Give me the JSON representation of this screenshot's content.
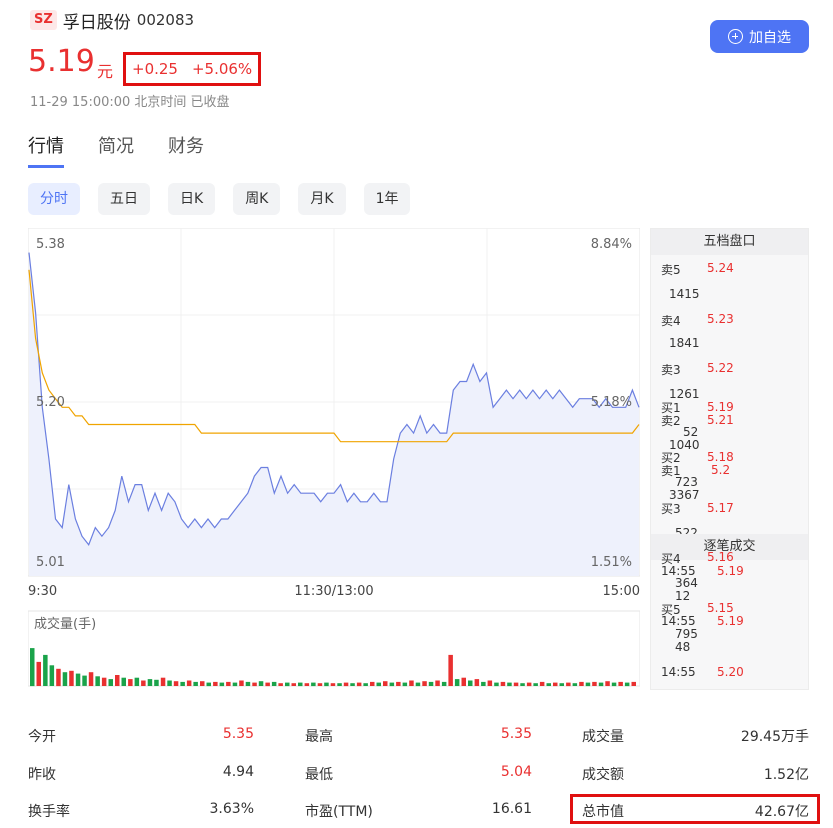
{
  "stock": {
    "market": "SZ",
    "name": "孚日股份",
    "code": "002083",
    "price": "5.19",
    "unit": "元",
    "change": "+0.25",
    "change_pct": "+5.06%",
    "timestamp": "11-29 15:00:00 北京时间 已收盘"
  },
  "add_button_label": "加自选",
  "tabs": [
    "行情",
    "简况",
    "财务"
  ],
  "period_tabs": [
    "分时",
    "五日",
    "日K",
    "周K",
    "月K",
    "1年"
  ],
  "chart_data": {
    "type": "line",
    "y_left_ticks": [
      "5.38",
      "5.20",
      "5.01"
    ],
    "y_right_ticks": [
      "8.84%",
      "5.18%",
      "1.51%"
    ],
    "x_ticks": [
      "9:30",
      "11:30/13:00",
      "15:00"
    ],
    "volume_label": "成交量(手)",
    "ylim": [
      5.01,
      5.38
    ],
    "prev_close": 4.94,
    "series": [
      {
        "color": "#6b7fe0",
        "values": [
          5.37,
          5.3,
          5.19,
          5.13,
          5.06,
          5.05,
          5.1,
          5.06,
          5.04,
          5.03,
          5.05,
          5.04,
          5.05,
          5.07,
          5.11,
          5.08,
          5.1,
          5.1,
          5.07,
          5.09,
          5.07,
          5.09,
          5.08,
          5.06,
          5.05,
          5.06,
          5.05,
          5.06,
          5.05,
          5.06,
          5.06,
          5.07,
          5.08,
          5.09,
          5.11,
          5.12,
          5.12,
          5.09,
          5.11,
          5.09,
          5.1,
          5.09,
          5.09,
          5.09,
          5.08,
          5.09,
          5.09,
          5.1,
          5.08,
          5.09,
          5.08,
          5.08,
          5.09,
          5.08,
          5.08,
          5.13,
          5.16,
          5.17,
          5.16,
          5.18,
          5.16,
          5.17,
          5.16,
          5.16,
          5.21,
          5.22,
          5.22,
          5.24,
          5.22,
          5.23,
          5.19,
          5.2,
          5.21,
          5.2,
          5.21,
          5.2,
          5.21,
          5.2,
          5.21,
          5.2,
          5.21,
          5.2,
          5.19,
          5.2,
          5.2,
          5.2,
          5.19,
          5.2,
          5.19,
          5.19,
          5.19,
          5.21,
          5.19
        ]
      },
      {
        "color": "#f0a400",
        "values": [
          5.35,
          5.27,
          5.23,
          5.21,
          5.2,
          5.19,
          5.19,
          5.18,
          5.18,
          5.17,
          5.17,
          5.17,
          5.17,
          5.17,
          5.17,
          5.17,
          5.17,
          5.17,
          5.17,
          5.17,
          5.17,
          5.17,
          5.17,
          5.17,
          5.17,
          5.17,
          5.16,
          5.16,
          5.16,
          5.16,
          5.16,
          5.16,
          5.16,
          5.16,
          5.16,
          5.16,
          5.16,
          5.16,
          5.16,
          5.16,
          5.16,
          5.16,
          5.16,
          5.16,
          5.16,
          5.16,
          5.16,
          5.15,
          5.15,
          5.15,
          5.15,
          5.15,
          5.15,
          5.15,
          5.15,
          5.15,
          5.15,
          5.15,
          5.15,
          5.15,
          5.15,
          5.15,
          5.15,
          5.15,
          5.16,
          5.16,
          5.16,
          5.16,
          5.16,
          5.16,
          5.16,
          5.16,
          5.16,
          5.16,
          5.16,
          5.16,
          5.16,
          5.16,
          5.16,
          5.16,
          5.16,
          5.16,
          5.16,
          5.16,
          5.16,
          5.16,
          5.16,
          5.16,
          5.16,
          5.16,
          5.16,
          5.16,
          5.17
        ]
      }
    ],
    "volume": [
      {
        "v": 0.55,
        "up": false
      },
      {
        "v": 0.35,
        "up": true
      },
      {
        "v": 0.45,
        "up": false
      },
      {
        "v": 0.3,
        "up": false
      },
      {
        "v": 0.25,
        "up": true
      },
      {
        "v": 0.2,
        "up": false
      },
      {
        "v": 0.22,
        "up": true
      },
      {
        "v": 0.18,
        "up": false
      },
      {
        "v": 0.15,
        "up": false
      },
      {
        "v": 0.2,
        "up": true
      },
      {
        "v": 0.14,
        "up": false
      },
      {
        "v": 0.12,
        "up": true
      },
      {
        "v": 0.1,
        "up": false
      },
      {
        "v": 0.16,
        "up": true
      },
      {
        "v": 0.12,
        "up": false
      },
      {
        "v": 0.1,
        "up": true
      },
      {
        "v": 0.12,
        "up": false
      },
      {
        "v": 0.08,
        "up": true
      },
      {
        "v": 0.1,
        "up": false
      },
      {
        "v": 0.09,
        "up": false
      },
      {
        "v": 0.12,
        "up": true
      },
      {
        "v": 0.08,
        "up": false
      },
      {
        "v": 0.07,
        "up": true
      },
      {
        "v": 0.06,
        "up": false
      },
      {
        "v": 0.08,
        "up": true
      },
      {
        "v": 0.06,
        "up": false
      },
      {
        "v": 0.07,
        "up": true
      },
      {
        "v": 0.05,
        "up": false
      },
      {
        "v": 0.06,
        "up": true
      },
      {
        "v": 0.05,
        "up": false
      },
      {
        "v": 0.06,
        "up": true
      },
      {
        "v": 0.05,
        "up": false
      },
      {
        "v": 0.08,
        "up": true
      },
      {
        "v": 0.06,
        "up": false
      },
      {
        "v": 0.05,
        "up": true
      },
      {
        "v": 0.07,
        "up": false
      },
      {
        "v": 0.05,
        "up": true
      },
      {
        "v": 0.06,
        "up": false
      },
      {
        "v": 0.04,
        "up": true
      },
      {
        "v": 0.05,
        "up": false
      },
      {
        "v": 0.04,
        "up": true
      },
      {
        "v": 0.05,
        "up": false
      },
      {
        "v": 0.04,
        "up": true
      },
      {
        "v": 0.05,
        "up": false
      },
      {
        "v": 0.04,
        "up": true
      },
      {
        "v": 0.05,
        "up": false
      },
      {
        "v": 0.04,
        "up": true
      },
      {
        "v": 0.04,
        "up": false
      },
      {
        "v": 0.05,
        "up": true
      },
      {
        "v": 0.04,
        "up": false
      },
      {
        "v": 0.05,
        "up": true
      },
      {
        "v": 0.04,
        "up": false
      },
      {
        "v": 0.06,
        "up": true
      },
      {
        "v": 0.05,
        "up": false
      },
      {
        "v": 0.07,
        "up": true
      },
      {
        "v": 0.05,
        "up": false
      },
      {
        "v": 0.06,
        "up": true
      },
      {
        "v": 0.05,
        "up": false
      },
      {
        "v": 0.08,
        "up": true
      },
      {
        "v": 0.05,
        "up": false
      },
      {
        "v": 0.07,
        "up": true
      },
      {
        "v": 0.06,
        "up": false
      },
      {
        "v": 0.08,
        "up": true
      },
      {
        "v": 0.06,
        "up": false
      },
      {
        "v": 0.45,
        "up": true
      },
      {
        "v": 0.1,
        "up": false
      },
      {
        "v": 0.12,
        "up": true
      },
      {
        "v": 0.08,
        "up": false
      },
      {
        "v": 0.1,
        "up": true
      },
      {
        "v": 0.06,
        "up": false
      },
      {
        "v": 0.08,
        "up": true
      },
      {
        "v": 0.05,
        "up": false
      },
      {
        "v": 0.06,
        "up": true
      },
      {
        "v": 0.05,
        "up": false
      },
      {
        "v": 0.05,
        "up": true
      },
      {
        "v": 0.04,
        "up": false
      },
      {
        "v": 0.05,
        "up": true
      },
      {
        "v": 0.04,
        "up": false
      },
      {
        "v": 0.06,
        "up": true
      },
      {
        "v": 0.04,
        "up": false
      },
      {
        "v": 0.05,
        "up": true
      },
      {
        "v": 0.04,
        "up": false
      },
      {
        "v": 0.05,
        "up": true
      },
      {
        "v": 0.04,
        "up": false
      },
      {
        "v": 0.06,
        "up": true
      },
      {
        "v": 0.05,
        "up": false
      },
      {
        "v": 0.06,
        "up": true
      },
      {
        "v": 0.05,
        "up": false
      },
      {
        "v": 0.07,
        "up": true
      },
      {
        "v": 0.05,
        "up": false
      },
      {
        "v": 0.06,
        "up": true
      },
      {
        "v": 0.05,
        "up": false
      },
      {
        "v": 0.06,
        "up": true
      }
    ]
  },
  "order_book": {
    "title": "五档盘口",
    "sells": [
      {
        "label": "卖5",
        "price": "5.24",
        "vol": "1415"
      },
      {
        "label": "卖4",
        "price": "5.23",
        "vol": "1841"
      },
      {
        "label": "卖3",
        "price": "5.22",
        "vol": "1261"
      },
      {
        "label": "卖2",
        "price": "5.21",
        "vol": "1040"
      },
      {
        "label": "卖1",
        "price": "5.2",
        "vol": "3367"
      }
    ],
    "buys": [
      {
        "label": "买1",
        "price": "5.19",
        "vol": "52"
      },
      {
        "label": "买2",
        "price": "5.18",
        "vol": "723"
      },
      {
        "label": "买3",
        "price": "5.17",
        "vol": "522"
      },
      {
        "label": "买4",
        "price": "5.16",
        "vol": "364"
      },
      {
        "label": "买5",
        "price": "5.15",
        "vol": "795"
      }
    ]
  },
  "trades": {
    "title": "逐笔成交",
    "items": [
      {
        "time": "14:55",
        "price": "5.19",
        "vol": "12"
      },
      {
        "time": "14:55",
        "price": "5.19",
        "vol": "48"
      },
      {
        "time": "14:55",
        "price": "5.20",
        "vol": ""
      }
    ]
  },
  "stats": [
    [
      {
        "label": "今开",
        "value": "5.35",
        "red": true
      },
      {
        "label": "最高",
        "value": "5.35",
        "red": true
      },
      {
        "label": "成交量",
        "value": "29.45万手",
        "red": false
      }
    ],
    [
      {
        "label": "昨收",
        "value": "4.94",
        "red": false
      },
      {
        "label": "最低",
        "value": "5.04",
        "red": true
      },
      {
        "label": "成交额",
        "value": "1.52亿",
        "red": false
      }
    ],
    [
      {
        "label": "换手率",
        "value": "3.63%",
        "red": false
      },
      {
        "label": "市盈(TTM)",
        "value": "16.61",
        "red": false
      },
      {
        "label": "总市值",
        "value": "42.67亿",
        "red": false
      }
    ]
  ]
}
